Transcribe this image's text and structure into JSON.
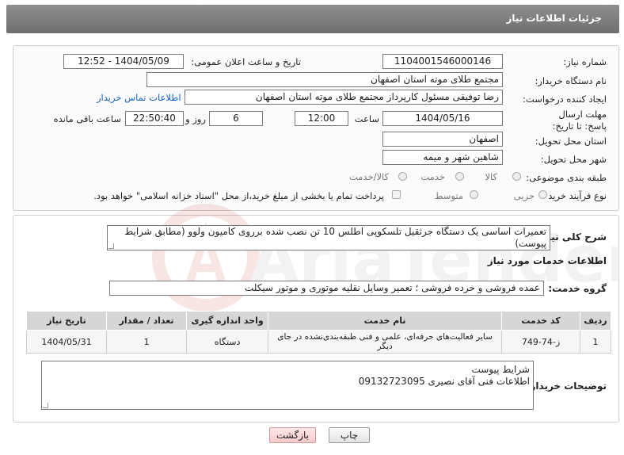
{
  "header": {
    "title": "جزئیات اطلاعات نیاز"
  },
  "form": {
    "need_number": {
      "label": "شماره نیاز:",
      "value": "1104001546000146"
    },
    "announce_datetime": {
      "label": "تاریخ و ساعت اعلان عمومی:",
      "value": "1404/05/09 - 12:52"
    },
    "buyer_org": {
      "label": "نام دستگاه خریدار:",
      "value": "مجتمع طلای موته استان اصفهان"
    },
    "requester": {
      "label": "ایجاد کننده درخواست:",
      "value": "رضا توفیقی مسئول کارپرداز مجتمع طلای موته استان اصفهان"
    },
    "buyer_contact_link": "اطلاعات تماس خریدار",
    "deadline": {
      "label": "مهلت ارسال پاسخ: تا تاریخ:",
      "date": "1404/05/16",
      "time_label": "ساعت",
      "time": "12:00",
      "days": "6",
      "days_label": "روز و",
      "remaining": "22:50:40",
      "remaining_label": "ساعت باقی مانده"
    },
    "province": {
      "label": "استان محل تحویل:",
      "value": "اصفهان"
    },
    "city": {
      "label": "شهر محل تحویل:",
      "value": "شاهین شهر و میمه"
    },
    "category": {
      "label": "طبقه بندی موضوعی:",
      "options": [
        "کالا",
        "خدمت",
        "کالا/خدمت"
      ]
    },
    "process": {
      "label": "نوع فرآیند خرید :",
      "options": [
        "جزیی",
        "متوسط"
      ],
      "payment_note": "پرداخت تمام یا بخشی از مبلغ خرید،از محل \"اسناد خزانه اسلامی\" خواهد بود."
    }
  },
  "summary": {
    "label": "شرح کلی نیاز:",
    "text": "تعمیرات اساسی یک دستگاه جرثقیل تلسکوپی اطلس 10 تن نصب شده برروی کامیون ولوو (مطابق شرایط پیوست)"
  },
  "services": {
    "section_title": "اطلاعات خدمات مورد نیاز",
    "group_label": "گروه خدمت:",
    "group_value": "عمده فروشی و خرده فروشی ؛ تعمیر وسایل نقلیه موتوری و موتور سیکلت",
    "columns": [
      "ردیف",
      "کد خدمت",
      "نام خدمت",
      "واحد اندازه گیری",
      "تعداد / مقدار",
      "تاریخ نیاز"
    ],
    "rows": [
      [
        "1",
        "ز-74-749",
        "سایر فعالیت‌های حرفه‌ای، علمی و فنی طبقه‌بندی‌نشده در جای دیگر",
        "دستگاه",
        "1",
        "1404/05/31"
      ]
    ]
  },
  "buyer_notes": {
    "label": "توضیحات خریدار:",
    "lines": [
      "شرایط پیوست",
      "اطلاعات فنی آقای نصیری 09132723095"
    ]
  },
  "buttons": {
    "print": "چاپ",
    "back": "بازگشت"
  },
  "colors": {
    "header_bg": "#7a7a7a",
    "link": "#1565c0",
    "back_button": "#f6caca"
  }
}
